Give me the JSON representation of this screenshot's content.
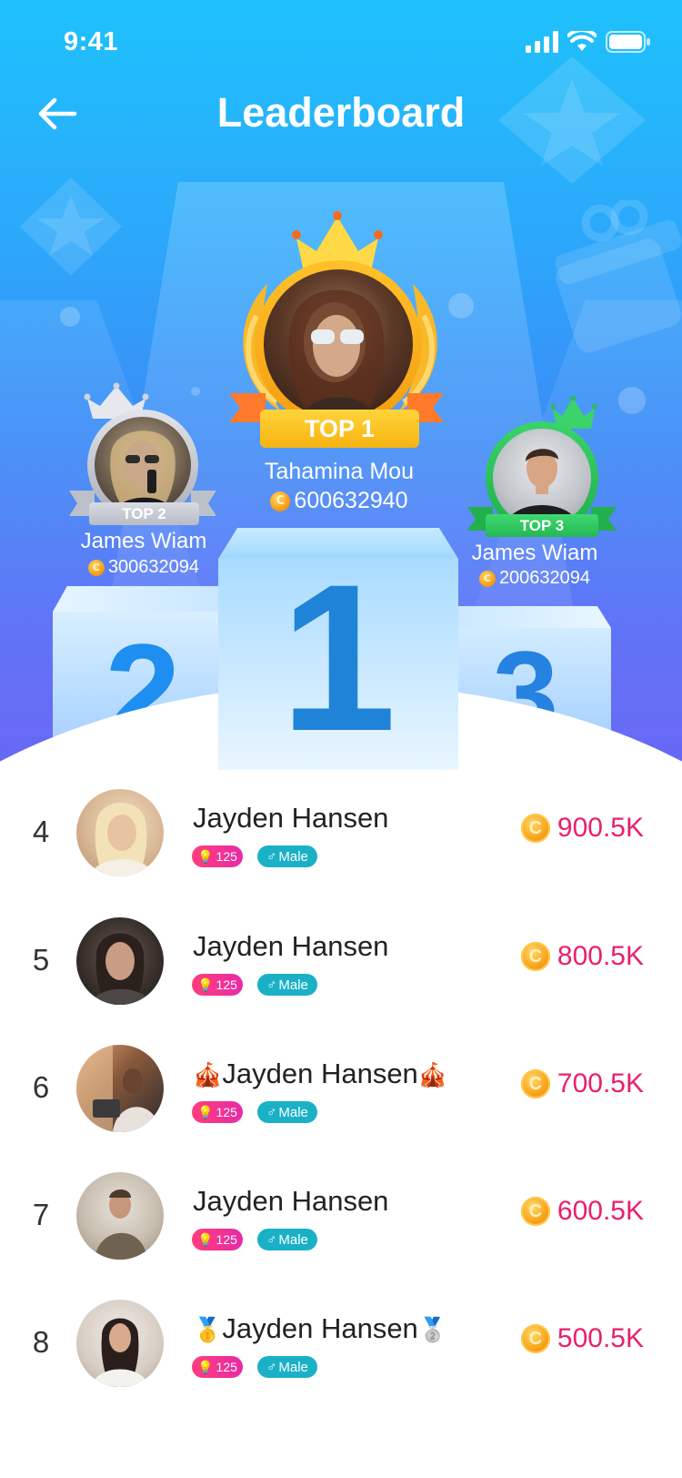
{
  "status_bar": {
    "time": "9:41"
  },
  "header": {
    "title": "Leaderboard"
  },
  "podium": [
    {
      "rank": "1",
      "badge": "TOP 1",
      "name": "Tahamina Mou",
      "coins": "600632940"
    },
    {
      "rank": "2",
      "badge": "TOP 2",
      "name": "James Wiam",
      "coins": "300632094"
    },
    {
      "rank": "3",
      "badge": "TOP 3",
      "name": "James Wiam",
      "coins": "200632094"
    }
  ],
  "list": [
    {
      "rank": "4",
      "name": "Jayden Hansen",
      "prefix": "",
      "suffix": "",
      "level": "125",
      "gender": "Male",
      "amount": "900.5K"
    },
    {
      "rank": "5",
      "name": "Jayden Hansen",
      "prefix": "",
      "suffix": "",
      "level": "125",
      "gender": "Male",
      "amount": "800.5K"
    },
    {
      "rank": "6",
      "name": "Jayden Hansen",
      "prefix": "🎪",
      "suffix": "🎪",
      "level": "125",
      "gender": "Male",
      "amount": "700.5K"
    },
    {
      "rank": "7",
      "name": "Jayden Hansen",
      "prefix": "",
      "suffix": "",
      "level": "125",
      "gender": "Male",
      "amount": "600.5K"
    },
    {
      "rank": "8",
      "name": "Jayden Hansen",
      "prefix": "🥇",
      "suffix": "🥈",
      "level": "125",
      "gender": "Male",
      "amount": "500.5K"
    }
  ],
  "colors": {
    "accent_amount": "#ea1f6b",
    "gold": "#f6b81c",
    "silver": "#c7c9cf",
    "green": "#28c251",
    "level_tag": "#ff3d7f",
    "gender_tag": "#1ab1c7"
  },
  "icons": {
    "back": "arrow-left-icon",
    "coin": "coin-icon",
    "crown": "crown-icon",
    "signal": "signal-icon",
    "wifi": "wifi-icon",
    "battery": "battery-icon",
    "level": "bulb-icon",
    "gender": "male-icon"
  }
}
